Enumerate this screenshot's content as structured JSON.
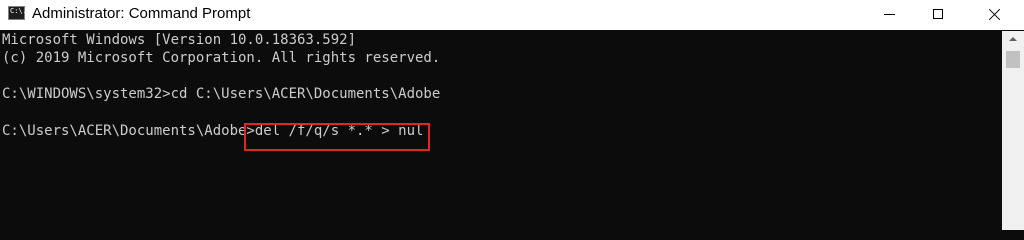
{
  "window": {
    "title": "Administrator: Command Prompt",
    "icon": "cmd-icon",
    "icon_text": "C:\\.",
    "controls": [
      "minimize",
      "maximize",
      "close"
    ]
  },
  "console": {
    "lines": [
      "Microsoft Windows [Version 10.0.18363.592]",
      "(c) 2019 Microsoft Corporation. All rights reserved.",
      "C:\\WINDOWS\\system32>cd C:\\Users\\ACER\\Documents\\Adobe",
      "C:\\Users\\ACER\\Documents\\Adobe>del /f/q/s *.* > nul"
    ],
    "highlighted_command": "del /f/q/s *.* > nul",
    "highlight_color": "#e02727",
    "background": "#0c0c0c",
    "text_color": "#cccccc"
  }
}
